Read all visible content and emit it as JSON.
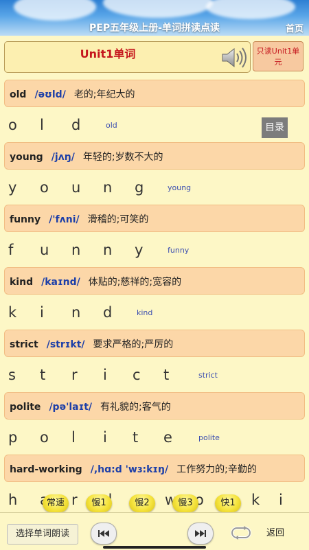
{
  "header": {
    "title": "PEP五年级上册-单词拼读点读",
    "home_label": "首页"
  },
  "unit": {
    "title": "Unit1单词",
    "only_label_line1": "只读Unit1单",
    "only_label_line2": "元",
    "speaker_icon": "speaker-icon"
  },
  "menu_label": "目录",
  "words": [
    {
      "word": "old",
      "phonetic": "/əʊld/",
      "meaning": "老的;年纪大的",
      "letters": [
        "o",
        "l",
        "d"
      ],
      "small": "old"
    },
    {
      "word": "young",
      "phonetic": "/jʌŋ/",
      "meaning": "年轻的;岁数不大的",
      "letters": [
        "y",
        "o",
        "u",
        "n",
        "g"
      ],
      "small": "young"
    },
    {
      "word": "funny",
      "phonetic": "/'fʌni/",
      "meaning": "滑稽的;可笑的",
      "letters": [
        "f",
        "u",
        "n",
        "n",
        "y"
      ],
      "small": "funny"
    },
    {
      "word": "kind",
      "phonetic": "/kaɪnd/",
      "meaning": "体贴的;慈祥的;宽容的",
      "letters": [
        "k",
        "i",
        "n",
        "d"
      ],
      "small": "kind"
    },
    {
      "word": "strict",
      "phonetic": "/strɪkt/",
      "meaning": "要求严格的;严厉的",
      "letters": [
        "s",
        "t",
        "r",
        "i",
        "c",
        "t"
      ],
      "small": "strict"
    },
    {
      "word": "polite",
      "phonetic": "/pə'laɪt/",
      "meaning": "有礼貌的;客气的",
      "letters": [
        "p",
        "o",
        "l",
        "i",
        "t",
        "e"
      ],
      "small": "polite"
    },
    {
      "word": "hard-working",
      "phonetic": "/,hɑ:d 'wɜ:kɪŋ/",
      "meaning": "工作努力的;辛勤的",
      "letters": [
        "h",
        "a",
        "r",
        "d",
        "-",
        "w",
        "o",
        "r",
        "k",
        "i"
      ],
      "small": ""
    }
  ],
  "speeds": [
    "常速",
    "慢1",
    "慢2",
    "慢3",
    "快1"
  ],
  "bottom": {
    "choose_label": "选择单词朗读",
    "prev_icon": "prev-icon",
    "next_icon": "next-icon",
    "loop_icon": "loop-icon",
    "back_label": "返回"
  }
}
